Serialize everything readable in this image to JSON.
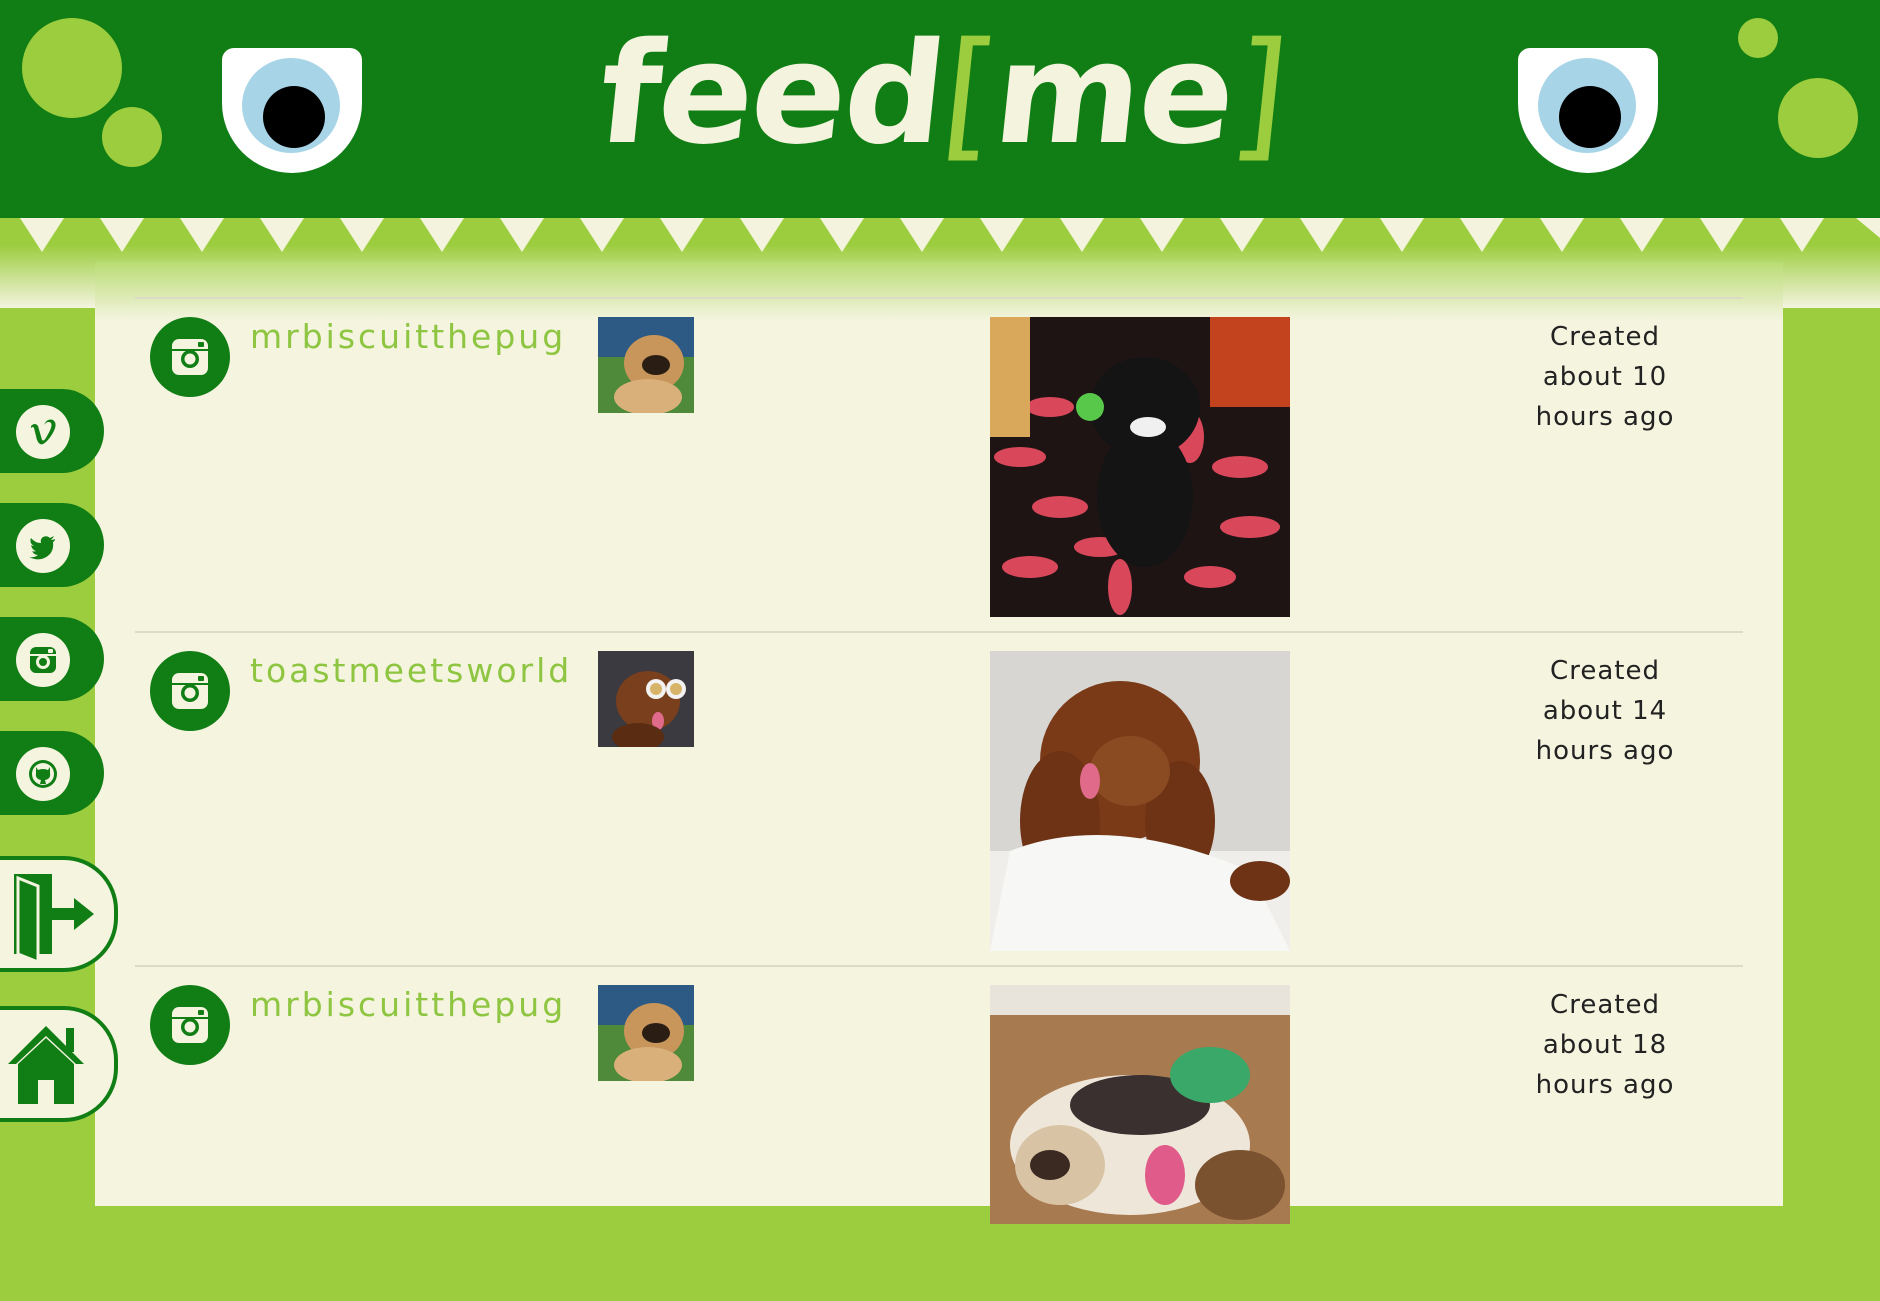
{
  "app": {
    "logo_text": "feed",
    "logo_bracket_open": "[",
    "logo_me": "me",
    "logo_bracket_close": "]"
  },
  "colors": {
    "dark_green": "#107e14",
    "light_green": "#9ccd3f",
    "cream": "#f4f4df",
    "username_green": "#8ec541"
  },
  "sidebar": {
    "items": [
      {
        "icon": "vimeo-icon"
      },
      {
        "icon": "twitter-icon"
      },
      {
        "icon": "instagram-icon"
      },
      {
        "icon": "github-icon"
      },
      {
        "icon": "logout-icon"
      },
      {
        "icon": "home-icon"
      }
    ]
  },
  "feed": {
    "posts": [
      {
        "source": "instagram-icon",
        "username": "mrbiscuitthepug",
        "created_line1": "Created",
        "created_line2": "about 10",
        "created_line3": "hours ago"
      },
      {
        "source": "instagram-icon",
        "username": "toastmeetsworld",
        "created_line1": "Created",
        "created_line2": "about 14",
        "created_line3": "hours ago"
      },
      {
        "source": "instagram-icon",
        "username": "mrbiscuitthepug",
        "created_line1": "Created",
        "created_line2": "about 18",
        "created_line3": "hours ago"
      }
    ]
  }
}
